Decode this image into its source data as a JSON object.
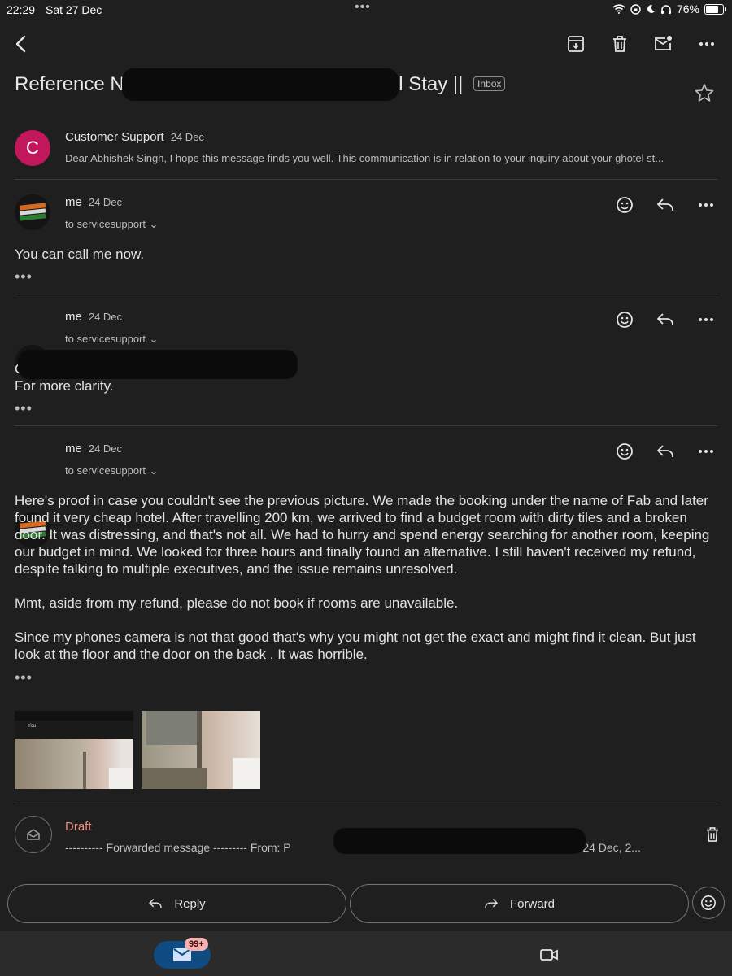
{
  "status_bar": {
    "time": "22:29",
    "date": "Sat 27 Dec",
    "battery": "76%"
  },
  "subject": {
    "prefix": "Reference No. 22707",
    "suffix": ": Hotel Stay ||",
    "label": "Inbox"
  },
  "thread": [
    {
      "sender": "Customer Support",
      "date": "24 Dec",
      "avatar_letter": "C",
      "snippet": "Dear Abhishek Singh, I hope this message finds you well. This communication is in relation to your inquiry about your ghotel st..."
    },
    {
      "sender": "me",
      "date": "24 Dec",
      "to": "to servicesupport",
      "body": "You can call me now."
    },
    {
      "sender": "me",
      "date": "24 Dec",
      "to": "to servicesupport",
      "body_line1": "Ca",
      "body_line2": "For more clarity."
    },
    {
      "sender": "me",
      "date": "24 Dec",
      "to": "to servicesupport",
      "paragraphs": [
        "Here's proof in case you couldn't see the previous picture. We made the booking under the name of Fab and later found it very cheap hotel. After travelling 200 km, we arrived to find a budget room with dirty tiles and a broken door. It was distressing, and that's not all. We had to hurry and spend energy searching for another room, keeping our budget in mind. We looked for three hours and finally found an alternative. I still haven't received my refund, despite talking to multiple executives, and the issue remains unresolved.",
        "Mmt, aside from my refund, please do not book if rooms are unavailable.",
        "Since my phones camera is not that good that's why you might not get the exact and might find it clean. But just look at the floor and the door on the back . It was horrible."
      ],
      "thumb1_label": "You"
    }
  ],
  "draft": {
    "label": "Draft",
    "text_left": "---------- Forwarded message --------- From: P",
    "text_right": "Date: Wed, 24 Dec, 2..."
  },
  "actions": {
    "reply": "Reply",
    "forward": "Forward"
  },
  "bottom_nav": {
    "badge": "99+"
  }
}
